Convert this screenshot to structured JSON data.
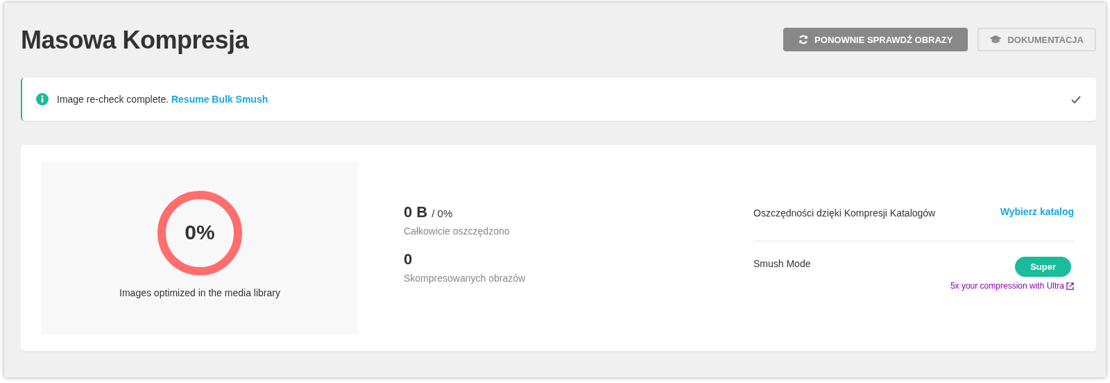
{
  "header": {
    "title": "Masowa Kompresja",
    "buttons": [
      {
        "label": "PONOWNIE SPRAWDŹ OBRAZY",
        "kind": "primary"
      },
      {
        "label": "DOKUMENTACJA",
        "kind": "ghost"
      }
    ]
  },
  "notice": {
    "text": "Image re-check complete.",
    "link": "Resume Bulk Smush"
  },
  "summary": {
    "ring": {
      "value": "0%",
      "caption": "Images optimized in the media library"
    },
    "stats": [
      {
        "value": "0 B",
        "extra": "/ 0%",
        "label": "Całkowicie oszczędzono"
      },
      {
        "value": "0",
        "label": "Skompresowanych obrazów"
      }
    ],
    "rows": [
      {
        "kind": "link",
        "label": "Oszczędności dzięki Kompresji Katalogów",
        "action": "Wybierz katalog"
      },
      {
        "kind": "mode",
        "label": "Smush Mode",
        "action": "Super",
        "note": "5x your compression with Ultra"
      }
    ]
  }
}
